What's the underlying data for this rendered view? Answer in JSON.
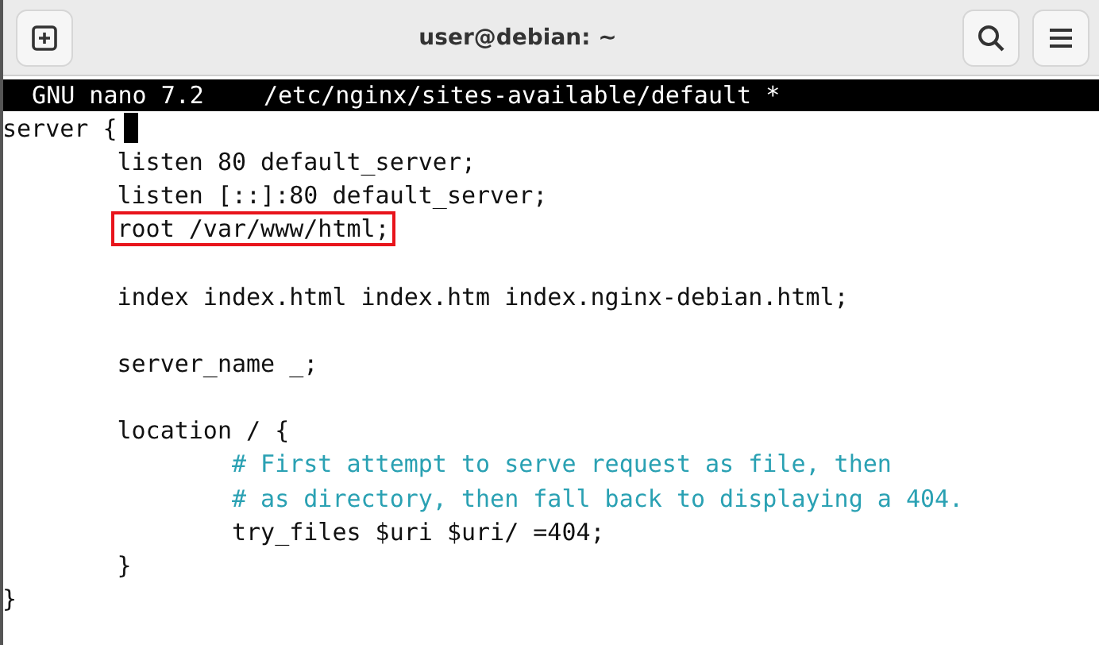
{
  "window": {
    "title": "user@debian: ~"
  },
  "nano_bar": {
    "version": "GNU nano 7.2",
    "file": "/etc/nginx/sites-available/default *"
  },
  "lines": [
    {
      "kind": "code",
      "text": "server {",
      "cursor": true,
      "highlighted": false
    },
    {
      "kind": "code",
      "text": "        listen 80 default_server;",
      "cursor": false,
      "highlighted": false
    },
    {
      "kind": "code",
      "text": "        listen [::]:80 default_server;",
      "cursor": false,
      "highlighted": false
    },
    {
      "kind": "code",
      "text": "        root /var/www/html;",
      "cursor": false,
      "highlighted": true
    },
    {
      "kind": "blank"
    },
    {
      "kind": "code",
      "text": "        index index.html index.htm index.nginx-debian.html;",
      "cursor": false,
      "highlighted": false
    },
    {
      "kind": "blank"
    },
    {
      "kind": "code",
      "text": "        server_name _;",
      "cursor": false,
      "highlighted": false
    },
    {
      "kind": "blank"
    },
    {
      "kind": "code",
      "text": "        location / {",
      "cursor": false,
      "highlighted": false
    },
    {
      "kind": "comment",
      "text": "                # First attempt to serve request as file, then",
      "cursor": false,
      "highlighted": false
    },
    {
      "kind": "comment",
      "text": "                # as directory, then fall back to displaying a 404.",
      "cursor": false,
      "highlighted": false
    },
    {
      "kind": "code",
      "text": "                try_files $uri $uri/ =404;",
      "cursor": false,
      "highlighted": false
    },
    {
      "kind": "code",
      "text": "        }",
      "cursor": false,
      "highlighted": false
    },
    {
      "kind": "code",
      "text": "}",
      "cursor": false,
      "highlighted": false
    }
  ]
}
